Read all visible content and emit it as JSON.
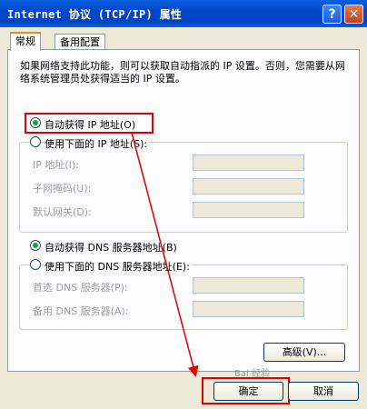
{
  "window": {
    "title": "Internet 协议 (TCP/IP) 属性",
    "help_label": "?",
    "close_label": "✕"
  },
  "tabs": [
    {
      "label": "常规",
      "active": true
    },
    {
      "label": "备用配置",
      "active": false
    }
  ],
  "description": "如果网络支持此功能，则可以获取自动指派的 IP 设置。否则，您需要从网络系统管理员处获得适当的 IP 设置。",
  "ip": {
    "auto_label": "自动获得 IP 地址(O)",
    "manual_label": "使用下面的 IP 地址(S):",
    "fields": [
      {
        "label": "IP 地址(I):"
      },
      {
        "label": "子网掩码(U):"
      },
      {
        "label": "默认网关(D):"
      }
    ]
  },
  "dns": {
    "auto_label": "自动获得 DNS 服务器地址(B)",
    "manual_label": "使用下面的 DNS 服务器地址(E):",
    "fields": [
      {
        "label": "首选 DNS 服务器(P):"
      },
      {
        "label": "备用 DNS 服务器(A):"
      }
    ]
  },
  "buttons": {
    "advanced": "高级(V)...",
    "ok": "确定",
    "cancel": "取消"
  },
  "watermark": "Bai 经验"
}
